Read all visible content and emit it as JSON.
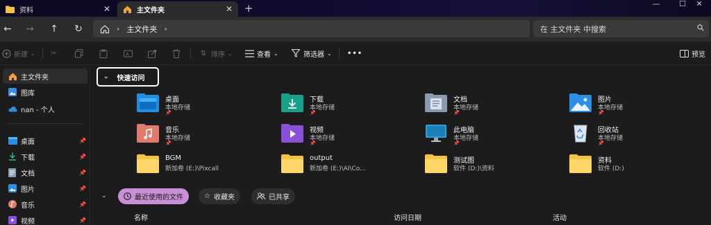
{
  "tabs": [
    {
      "label": "资料",
      "active": false
    },
    {
      "label": "主文件夹",
      "active": true
    }
  ],
  "window_controls": [
    "—",
    "☐",
    "✕"
  ],
  "address": {
    "breadcrumb": [
      "主文件夹"
    ],
    "search_placeholder": "在 主文件夹 中搜索"
  },
  "toolbar": {
    "new_label": "新建",
    "sort_label": "排序",
    "view_label": "查看",
    "filter_label": "筛选器",
    "more_label": "•••",
    "preview_label": "预览"
  },
  "sidebar": {
    "top": [
      {
        "label": "主文件夹",
        "icon": "home-icon",
        "selected": true
      },
      {
        "label": "图库",
        "icon": "gallery-icon"
      },
      {
        "label": "nan - 个人",
        "icon": "cloud-icon"
      }
    ],
    "pinned": [
      {
        "label": "桌面",
        "icon": "desktop-icon"
      },
      {
        "label": "下载",
        "icon": "download-icon"
      },
      {
        "label": "文档",
        "icon": "document-icon"
      },
      {
        "label": "图片",
        "icon": "pictures-icon"
      },
      {
        "label": "音乐",
        "icon": "music-icon"
      },
      {
        "label": "视频",
        "icon": "video-icon"
      }
    ]
  },
  "quick_access": {
    "title": "快速访问",
    "items": [
      {
        "name": "桌面",
        "sub": "本地存储",
        "icon": "desktop-folder-icon",
        "color": "#1e8fe8"
      },
      {
        "name": "下载",
        "sub": "本地存储",
        "icon": "download-folder-icon",
        "color": "#19a08a"
      },
      {
        "name": "文档",
        "sub": "本地存储",
        "icon": "document-folder-icon",
        "color": "#8a9bb0"
      },
      {
        "name": "图片",
        "sub": "本地存储",
        "icon": "pictures-folder-icon",
        "color": "#2d8ee6"
      },
      {
        "name": "音乐",
        "sub": "本地存储",
        "icon": "music-folder-icon",
        "color": "#e07a6a"
      },
      {
        "name": "视频",
        "sub": "本地存储",
        "icon": "video-folder-icon",
        "color": "#8b4fd8"
      },
      {
        "name": "此电脑",
        "sub": "本地存储",
        "icon": "computer-icon",
        "color": "#2a9fd8"
      },
      {
        "name": "回收站",
        "sub": "本地存储",
        "icon": "recycle-bin-icon",
        "color": "#cfd6de"
      },
      {
        "name": "BGM",
        "sub": "新加卷 (E:)\\Pixcall",
        "icon": "folder-icon",
        "color": "#f5c242"
      },
      {
        "name": "output",
        "sub": "新加卷 (E:)\\AI\\Co...",
        "icon": "folder-icon",
        "color": "#f5c242"
      },
      {
        "name": "测试图",
        "sub": "软件 (D:)\\资料",
        "icon": "folder-icon",
        "color": "#f5c242"
      },
      {
        "name": "资料",
        "sub": "软件 (D:)",
        "icon": "folder-icon",
        "color": "#f5c242"
      }
    ]
  },
  "recent_tabs": [
    {
      "label": "最近使用的文件",
      "icon": "clock-icon",
      "active": true
    },
    {
      "label": "收藏夹",
      "icon": "star-icon",
      "active": false
    },
    {
      "label": "已共享",
      "icon": "people-icon",
      "active": false
    }
  ],
  "columns": [
    "名称",
    "访问日期",
    "活动"
  ]
}
